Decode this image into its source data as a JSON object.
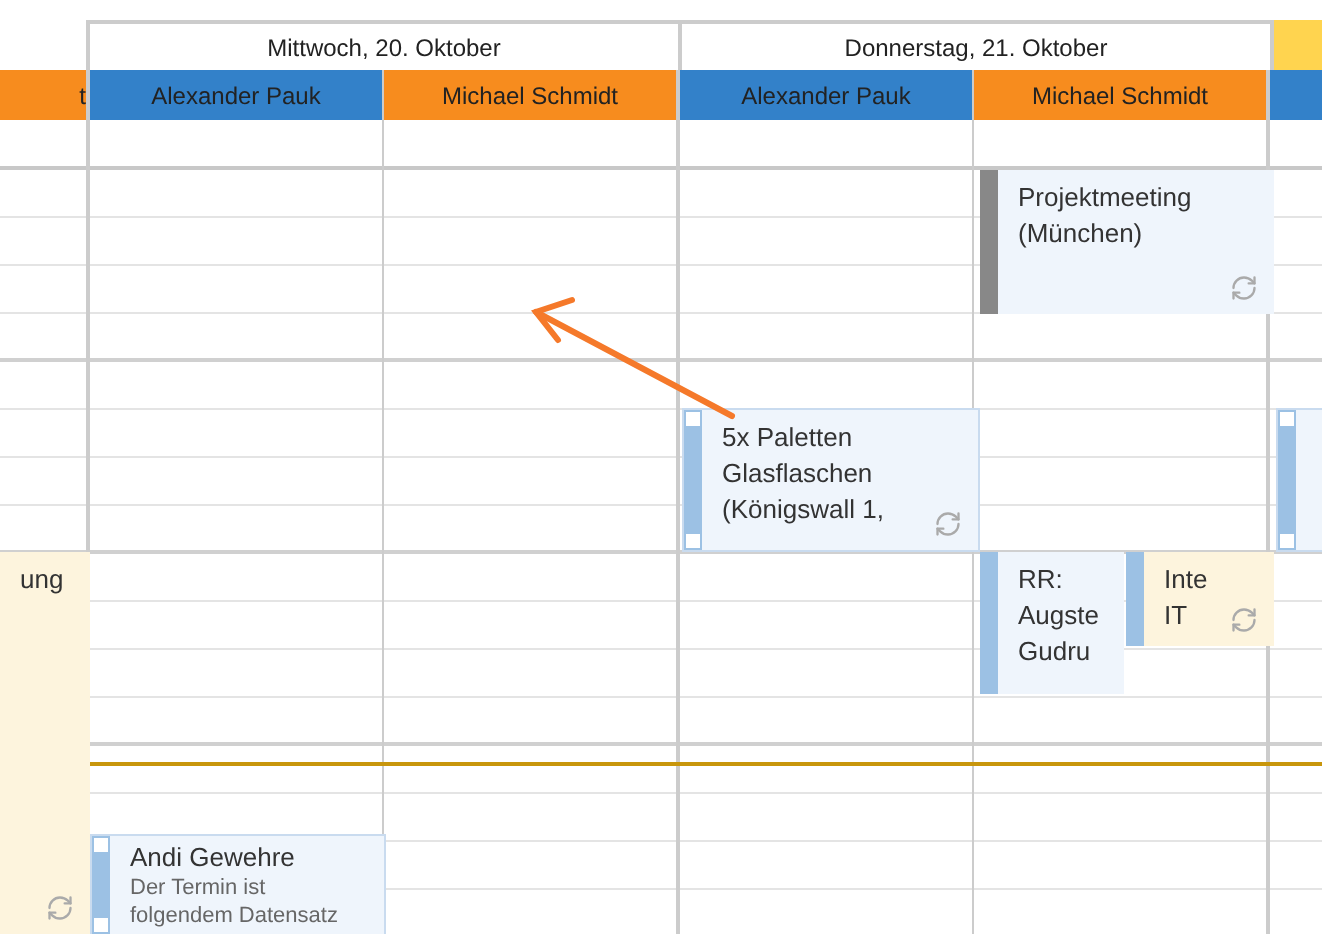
{
  "left_column": {
    "resource": {
      "name": "t",
      "color": "#f78c1e"
    }
  },
  "days": [
    {
      "label": "Mittwoch, 20. Oktober",
      "resources": [
        {
          "name": "Alexander Pauk",
          "color": "#3381c9"
        },
        {
          "name": "Michael Schmidt",
          "color": "#f78c1e"
        }
      ]
    },
    {
      "label": "Donnerstag, 21. Oktober",
      "resources": [
        {
          "name": "Alexander Pauk",
          "color": "#3381c9"
        },
        {
          "name": "Michael Schmidt",
          "color": "#f78c1e"
        }
      ]
    }
  ],
  "right_column": {
    "day": {
      "color": "#ffd44f"
    },
    "resource": {
      "color": "#3381c9"
    }
  },
  "appointments": [
    {
      "lines": [
        "ung"
      ],
      "highlighted": true,
      "recurring": true,
      "selected": false
    },
    {
      "lines": [
        "Projektmeeting",
        "(München)"
      ],
      "color": "#888888",
      "highlighted": false,
      "recurring": true,
      "selected": false
    },
    {
      "lines": [
        "5x Paletten",
        "Glasflaschen",
        "(Königswall 1,"
      ],
      "color": "#9cc1e4",
      "highlighted": false,
      "recurring": true,
      "selected": true
    },
    {
      "color": "#9cc1e4",
      "highlighted": false,
      "recurring": false,
      "selected": true
    },
    {
      "lines": [
        "RR:",
        "Augste",
        "Gudru"
      ],
      "color": "#9cc1e4",
      "highlighted": false,
      "recurring": false,
      "selected": false
    },
    {
      "lines": [
        "Inte",
        "IT"
      ],
      "color": "#9cc1e4",
      "highlighted": true,
      "recurring": true,
      "selected": false
    },
    {
      "lines": [
        "Andi Gewehre"
      ],
      "description": "Der Termin ist folgendem Datensatz",
      "color": "#9cc1e4",
      "highlighted": false,
      "recurring": false,
      "selected": true
    }
  ]
}
